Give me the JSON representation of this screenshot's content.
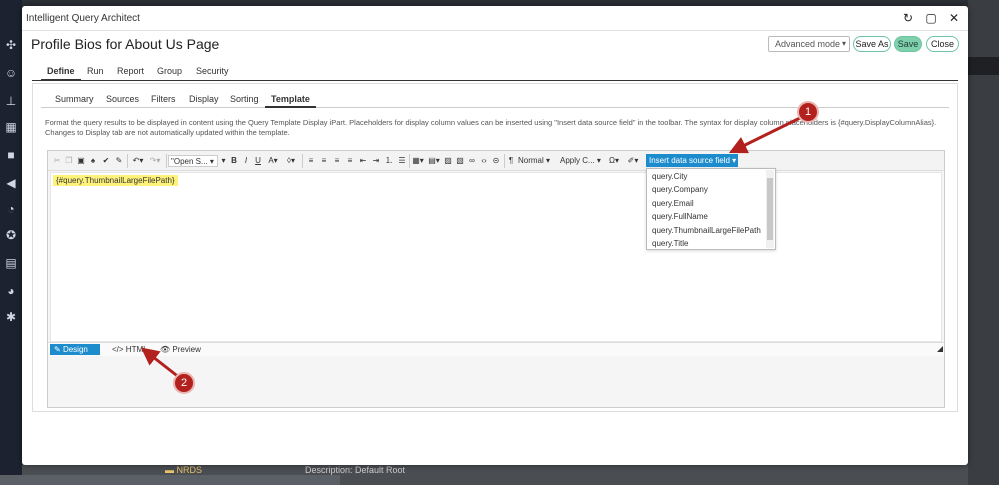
{
  "window": {
    "app_title": "Intelligent Query Architect",
    "page_title": "Profile Bios for About Us Page",
    "mode_select": "Advanced mode",
    "buttons": {
      "save_as": "Save As",
      "save": "Save",
      "close": "Close"
    }
  },
  "main_tabs": [
    "Define",
    "Run",
    "Report",
    "Group",
    "Security"
  ],
  "sub_tabs": [
    "Summary",
    "Sources",
    "Filters",
    "Display",
    "Sorting",
    "Template"
  ],
  "info_text": "Format the query results to be displayed in content using the Query Template Display iPart. Placeholders for display column values can be inserted using \"Insert data source field\" in the toolbar. The syntax for display column placeholders is {#query.DisplayColumnAlias}. Changes to Display tab are not automatically updated within the template.",
  "toolbar": {
    "font_name": "\"Open S...",
    "paragraph": "Normal",
    "apply_css": "Apply C...",
    "insert_field": "Insert data source field"
  },
  "editor": {
    "placeholder_token": "{#query.ThumbnailLargeFilePath}"
  },
  "dropdown_items": [
    "query.City",
    "query.Company",
    "query.Email",
    "query.FullName",
    "query.ThumbnailLargeFilePath",
    "query.Title"
  ],
  "editor_modes": [
    "Design",
    "HTML",
    "Preview"
  ],
  "annotations": [
    "1",
    "2"
  ],
  "background": {
    "folder": "NRDS",
    "description": "Description: Default Root"
  },
  "colors": {
    "accent": "#1d8ccd",
    "save_btn": "#7fd1ad",
    "highlight": "#fff27a",
    "annotation": "#b3211e"
  }
}
